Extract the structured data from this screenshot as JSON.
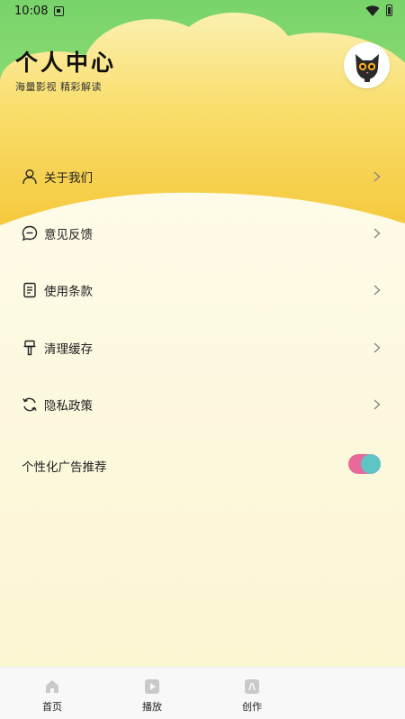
{
  "status_bar": {
    "time": "10:08",
    "icons": [
      "notification-icon",
      "wifi-icon",
      "battery-icon"
    ]
  },
  "header": {
    "title": "个人中心",
    "subtitle": "海量影视 精彩解读",
    "avatar_icon": "cat-avatar-icon"
  },
  "menu": {
    "items": [
      {
        "label": "关于我们",
        "icon": "user-icon"
      },
      {
        "label": "意见反馈",
        "icon": "chat-bubble-icon"
      },
      {
        "label": "使用条款",
        "icon": "document-icon"
      },
      {
        "label": "清理缓存",
        "icon": "brush-icon"
      },
      {
        "label": "隐私政策",
        "icon": "refresh-icon"
      }
    ]
  },
  "ad_setting": {
    "label": "个性化广告推荐",
    "enabled": true
  },
  "tab_bar": {
    "tabs": [
      {
        "label": "首页",
        "icon": "home-icon"
      },
      {
        "label": "播放",
        "icon": "play-icon"
      },
      {
        "label": "创作",
        "icon": "create-icon"
      }
    ]
  },
  "colors": {
    "header_green": "#7ed96d",
    "header_yellow": "#f7cf45",
    "page_background": "#fdf8dd",
    "toggle_track": "#e8689a",
    "toggle_knob": "#5ec5c5"
  }
}
